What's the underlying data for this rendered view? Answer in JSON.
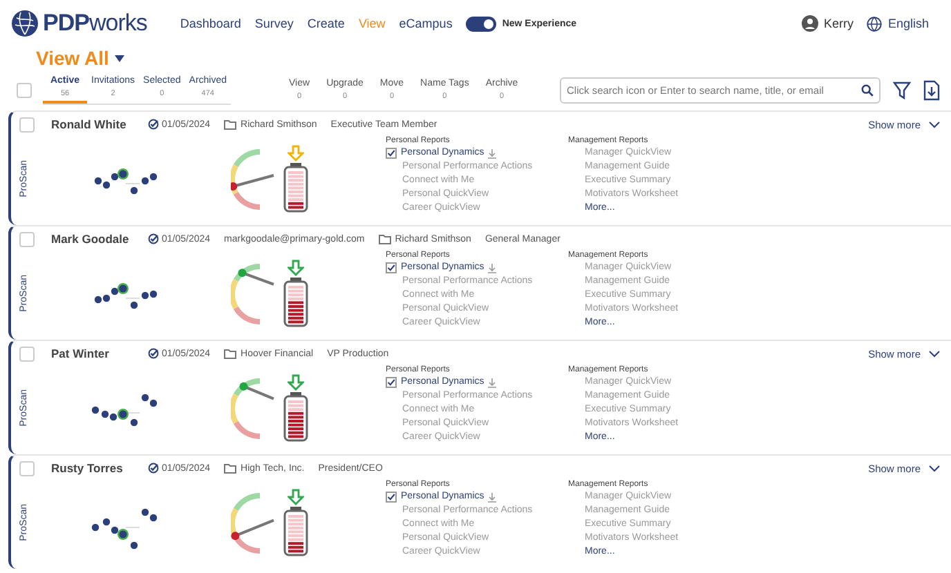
{
  "header": {
    "brand": {
      "strong": "PDP",
      "light": "works"
    },
    "nav": [
      {
        "label": "Dashboard",
        "selected": false
      },
      {
        "label": "Survey",
        "selected": false
      },
      {
        "label": "Create",
        "selected": false
      },
      {
        "label": "View",
        "selected": true
      },
      {
        "label": "eCampus",
        "selected": false
      }
    ],
    "toggle": {
      "label": "New Experience",
      "on": true
    },
    "user": "Kerry",
    "language": "English"
  },
  "page_title": "View All",
  "tabs": [
    {
      "label": "Active",
      "count": "56",
      "selected": true
    },
    {
      "label": "Invitations",
      "count": "2",
      "selected": false
    },
    {
      "label": "Selected",
      "count": "0",
      "selected": false
    },
    {
      "label": "Archived",
      "count": "474",
      "selected": false
    }
  ],
  "actions": [
    {
      "label": "View",
      "count": "0"
    },
    {
      "label": "Upgrade",
      "count": "0"
    },
    {
      "label": "Move",
      "count": "0"
    },
    {
      "label": "Name Tags",
      "count": "0"
    },
    {
      "label": "Archive",
      "count": "0"
    }
  ],
  "select_all": {
    "checked": false
  },
  "search": {
    "placeholder": "Click search icon or Enter to search name, title, or email"
  },
  "people": [
    {
      "checked": false,
      "name": "Ronald White",
      "date": "01/05/2024",
      "folder": "Richard Smithson",
      "title": "Executive Team Member",
      "show_more": "Show more",
      "assessment": "ProScan",
      "gauge": {
        "level": 0.42,
        "color": "#c8202f"
      },
      "battery": {
        "level": 0.15
      },
      "arrow": {
        "color": "#f2b400"
      },
      "personal_reports_title": "Personal Reports",
      "personal_reports": [
        {
          "label": "Personal Dynamics",
          "checked": true
        },
        {
          "label": "Personal Performance Actions",
          "checked": false
        },
        {
          "label": "Connect with Me",
          "checked": false
        },
        {
          "label": "Personal QuickView",
          "checked": false
        },
        {
          "label": "Career QuickView",
          "checked": false
        }
      ],
      "management_reports_title": "Management Reports",
      "management_reports": [
        "Manager QuickView",
        "Management Guide",
        "Executive Summary",
        "Motivators Worksheet"
      ],
      "more": "More..."
    },
    {
      "checked": false,
      "name": "Mark Goodale",
      "date": "01/05/2024",
      "email": "markgoodale@primary-gold.com",
      "folder": "Richard Smithson",
      "title": "General Manager",
      "assessment": "ProScan",
      "gauge": {
        "level": 0.78,
        "color": "#1fa83f"
      },
      "battery": {
        "level": 0.55
      },
      "arrow": {
        "color": "#2fa84f"
      },
      "personal_reports_title": "Personal Reports",
      "personal_reports": [
        {
          "label": "Personal Dynamics",
          "checked": true
        },
        {
          "label": "Personal Performance Actions",
          "checked": false
        },
        {
          "label": "Connect with Me",
          "checked": false
        },
        {
          "label": "Personal QuickView",
          "checked": false
        },
        {
          "label": "Career QuickView",
          "checked": false
        }
      ],
      "management_reports_title": "Management Reports",
      "management_reports": [
        "Manager QuickView",
        "Management Guide",
        "Executive Summary",
        "Motivators Worksheet"
      ],
      "more": "More..."
    },
    {
      "checked": false,
      "name": "Pat Winter",
      "date": "01/05/2024",
      "folder": "Hoover Financial",
      "title": "VP Production",
      "show_more": "Show more",
      "assessment": "ProScan",
      "gauge": {
        "level": 0.8,
        "color": "#1fa83f"
      },
      "battery": {
        "level": 0.7
      },
      "arrow": {
        "color": "#2fa84f"
      },
      "personal_reports_title": "Personal Reports",
      "personal_reports": [
        {
          "label": "Personal Dynamics",
          "checked": true
        },
        {
          "label": "Personal Performance Actions",
          "checked": false
        },
        {
          "label": "Connect with Me",
          "checked": false
        },
        {
          "label": "Personal QuickView",
          "checked": false
        },
        {
          "label": "Career QuickView",
          "checked": false
        }
      ],
      "management_reports_title": "Management Reports",
      "management_reports": [
        "Manager QuickView",
        "Management Guide",
        "Executive Summary",
        "Motivators Worksheet"
      ],
      "more": "More..."
    },
    {
      "checked": false,
      "name": "Rusty Torres",
      "date": "01/05/2024",
      "folder": "High Tech, Inc.",
      "title": "President/CEO",
      "show_more": "Show more",
      "assessment": "ProScan",
      "gauge": {
        "level": 0.35,
        "color": "#c8202f"
      },
      "battery": {
        "level": 0.3
      },
      "arrow": {
        "color": "#2fa84f"
      },
      "personal_reports_title": "Personal Reports",
      "personal_reports": [
        {
          "label": "Personal Dynamics",
          "checked": true
        },
        {
          "label": "Personal Performance Actions",
          "checked": false
        },
        {
          "label": "Connect with Me",
          "checked": false
        },
        {
          "label": "Personal QuickView",
          "checked": false
        },
        {
          "label": "Career QuickView",
          "checked": false
        }
      ],
      "management_reports_title": "Management Reports",
      "management_reports": [
        "Manager QuickView",
        "Management Guide",
        "Executive Summary",
        "Motivators Worksheet"
      ],
      "more": "More..."
    }
  ]
}
